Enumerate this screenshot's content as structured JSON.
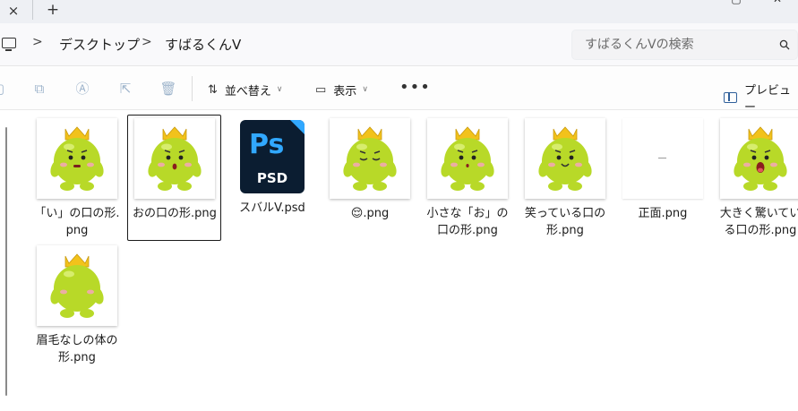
{
  "titlebar": {
    "close_glyph": "×",
    "new_tab_glyph": "+"
  },
  "address": {
    "crumbs": [
      "デスクトップ",
      "すばるくんV"
    ],
    "separator": ">"
  },
  "search": {
    "placeholder": "すばるくんVの検索"
  },
  "toolbar": {
    "sort_label": "並べ替え",
    "view_label": "表示",
    "more_glyph": "•••",
    "preview_label": "プレビュー"
  },
  "files": [
    {
      "name": "「い」の口の形.png",
      "type": "image",
      "mouth": "line",
      "eyes": "dot"
    },
    {
      "name": "おの口の形.png",
      "type": "image",
      "mouth": "o",
      "eyes": "dot",
      "selected": true
    },
    {
      "name": "スバルV.psd",
      "type": "psd",
      "icon_text": "Ps",
      "icon_label": "PSD"
    },
    {
      "name": "😌.png",
      "type": "image",
      "mouth": "none",
      "eyes": "closed"
    },
    {
      "name": "小さな「お」の口の形.png",
      "type": "image",
      "mouth": "small-o",
      "eyes": "dot"
    },
    {
      "name": "笑っている口の形.png",
      "type": "image",
      "mouth": "smile",
      "eyes": "dot"
    },
    {
      "name": "正面.png",
      "type": "blank"
    },
    {
      "name": "大きく驚いている口の形.png",
      "type": "image",
      "mouth": "big-o",
      "eyes": "dot"
    },
    {
      "name": "眉毛なしの体の形.png",
      "type": "image",
      "mouth": "none",
      "eyes": "none"
    }
  ],
  "colors": {
    "mascot_body": "#b8d928",
    "crown": "#f2c21b",
    "psd_blue": "#31a8ff",
    "psd_bg": "#0b1d31"
  }
}
